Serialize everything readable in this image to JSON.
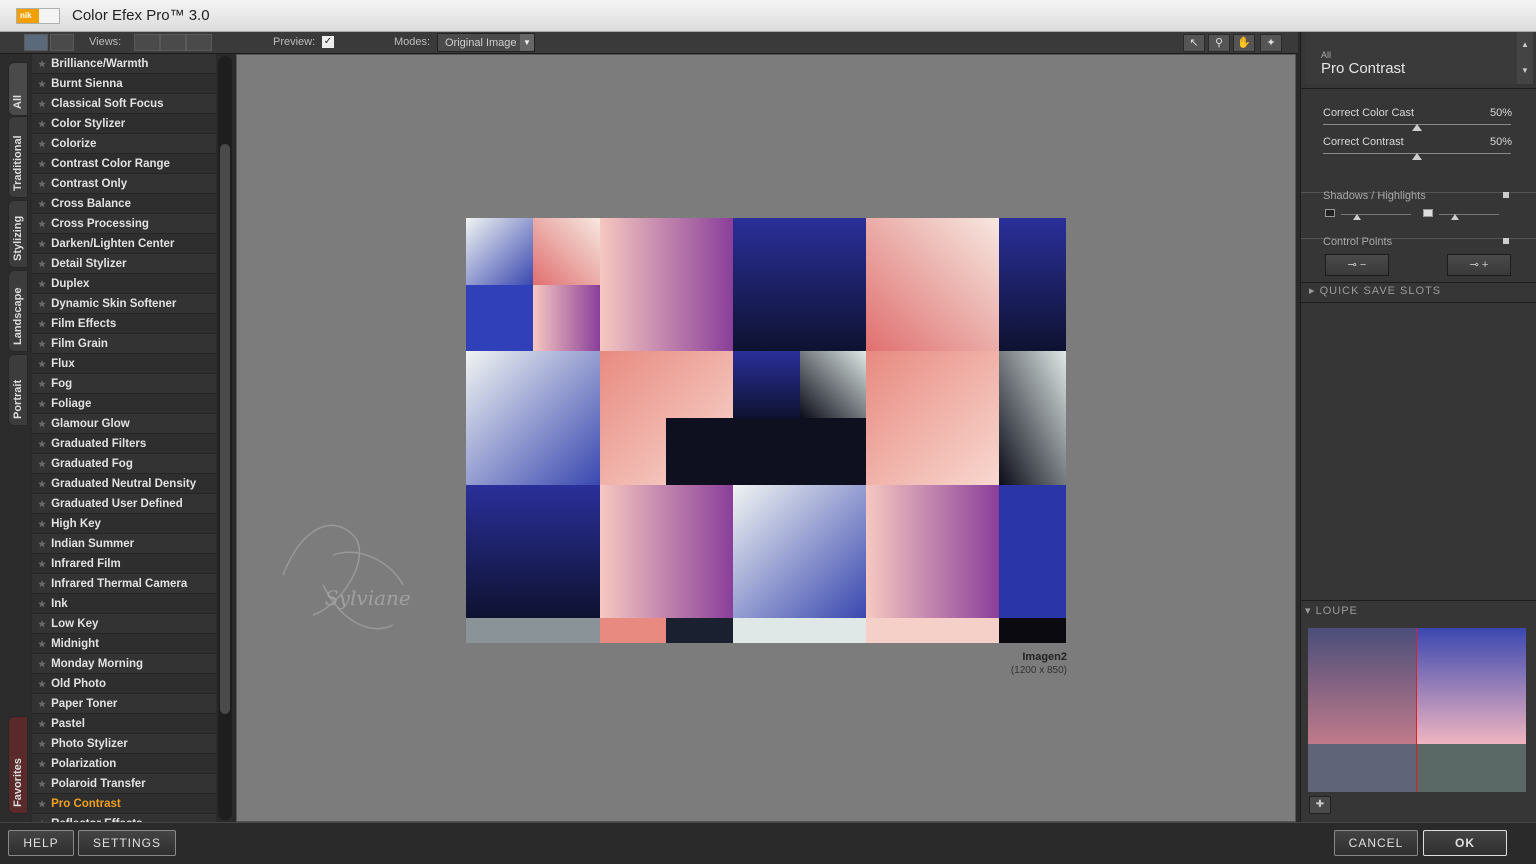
{
  "window": {
    "logo_text": "nik",
    "title": "Color Efex Pro™ 3.0"
  },
  "toolbar": {
    "views_label": "Views:",
    "preview_label": "Preview:",
    "preview_checked": "✓",
    "modes_label": "Modes:",
    "modes_value": "Original Image"
  },
  "side_tabs": [
    "All",
    "Traditional",
    "Stylizing",
    "Landscape",
    "Portrait"
  ],
  "favorites_tab": "Favorites",
  "filters": [
    "Brilliance/Warmth",
    "Burnt Sienna",
    "Classical Soft Focus",
    "Color Stylizer",
    "Colorize",
    "Contrast Color Range",
    "Contrast Only",
    "Cross Balance",
    "Cross Processing",
    "Darken/Lighten Center",
    "Detail Stylizer",
    "Duplex",
    "Dynamic Skin Softener",
    "Film Effects",
    "Film Grain",
    "Flux",
    "Fog",
    "Foliage",
    "Glamour Glow",
    "Graduated Filters",
    "Graduated Fog",
    "Graduated Neutral Density",
    "Graduated User Defined",
    "High Key",
    "Indian Summer",
    "Infrared Film",
    "Infrared Thermal Camera",
    "Ink",
    "Low Key",
    "Midnight",
    "Monday Morning",
    "Old Photo",
    "Paper Toner",
    "Pastel",
    "Photo Stylizer",
    "Polarization",
    "Polaroid Transfer",
    "Pro Contrast",
    "Reflector Effects"
  ],
  "active_filter": "Pro Contrast",
  "image": {
    "name": "Imagen2",
    "size": "(1200 x 850)"
  },
  "watermark": "Sylviane",
  "panel": {
    "category": "All",
    "filter_name": "Pro Contrast",
    "sliders": [
      {
        "label": "Correct Color Cast",
        "value": "50%",
        "level": 0.5
      },
      {
        "label": "Correct Contrast",
        "value": "50%",
        "level": 0.5
      }
    ],
    "shadows_highlights": "Shadows / Highlights",
    "control_points": "Control Points",
    "quick_save": "QUICK SAVE SLOTS",
    "loupe": "LOUPE"
  },
  "buttons": {
    "help": "HELP",
    "settings": "SETTINGS",
    "cancel": "CANCEL",
    "ok": "OK"
  },
  "colors": {
    "accent": "#f0a020",
    "preview_bg": "#7c7c7c"
  }
}
